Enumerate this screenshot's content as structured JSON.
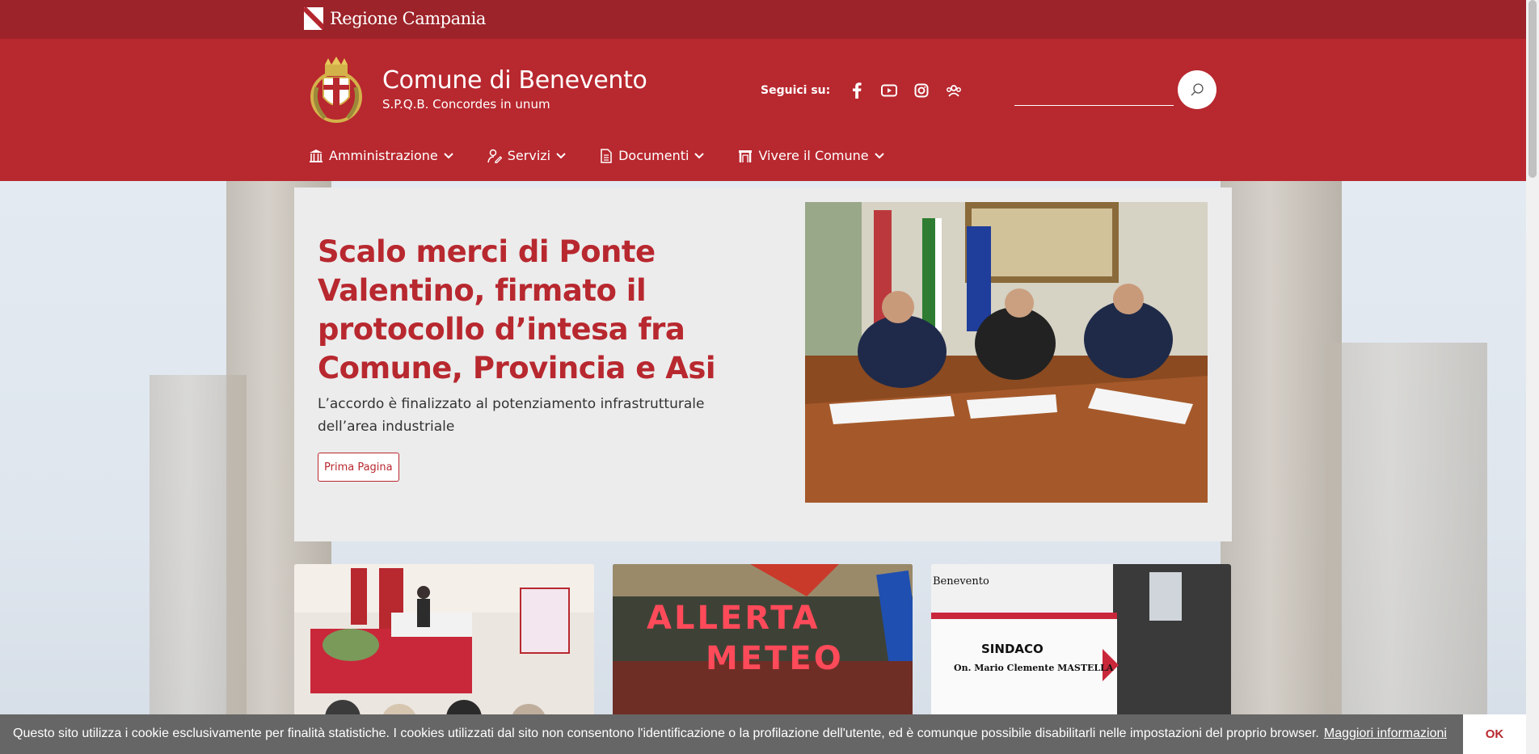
{
  "region": {
    "name": "Regione Campania"
  },
  "header": {
    "title": "Comune di Benevento",
    "subtitle": "S.P.Q.B. Concordes in unum",
    "social_label": "Seguici su:",
    "social_icons": [
      "facebook-icon",
      "youtube-icon",
      "instagram-icon",
      "community-icon"
    ],
    "search": {
      "value": "",
      "placeholder": ""
    }
  },
  "nav": {
    "items": [
      {
        "label": "Amministrazione",
        "icon": "building-icon"
      },
      {
        "label": "Servizi",
        "icon": "person-edit-icon"
      },
      {
        "label": "Documenti",
        "icon": "document-icon"
      },
      {
        "label": "Vivere il Comune",
        "icon": "monument-icon"
      }
    ]
  },
  "feature": {
    "title": "Scalo merci di Ponte Valentino, firmato il protocollo d’intesa fra Comune, Provincia e Asi",
    "description": "L’accordo è finalizzato al potenziamento infrastrutturale dell’area industriale",
    "button_label": "Prima Pagina"
  },
  "cards": [
    {
      "image_text": []
    },
    {
      "image_text": [
        "ALLERTA",
        "METEO"
      ]
    },
    {
      "image_text": [
        "Benevento",
        "SINDACO",
        "On. Mario Clemente MASTELLA"
      ]
    }
  ],
  "cookie": {
    "text": "Questo sito utilizza i cookie esclusivamente per finalità statistiche. I cookies utilizzati dal sito non consentono l'identificazione o la profilazione dell'utente, ed è comunque possibile disabilitarli nelle impostazioni del proprio browser.",
    "link": "Maggiori informazioni",
    "ok": "OK"
  },
  "colors": {
    "brand": "#b8282f",
    "region_bar": "#9c2329",
    "cookie_bg": "#666666"
  }
}
